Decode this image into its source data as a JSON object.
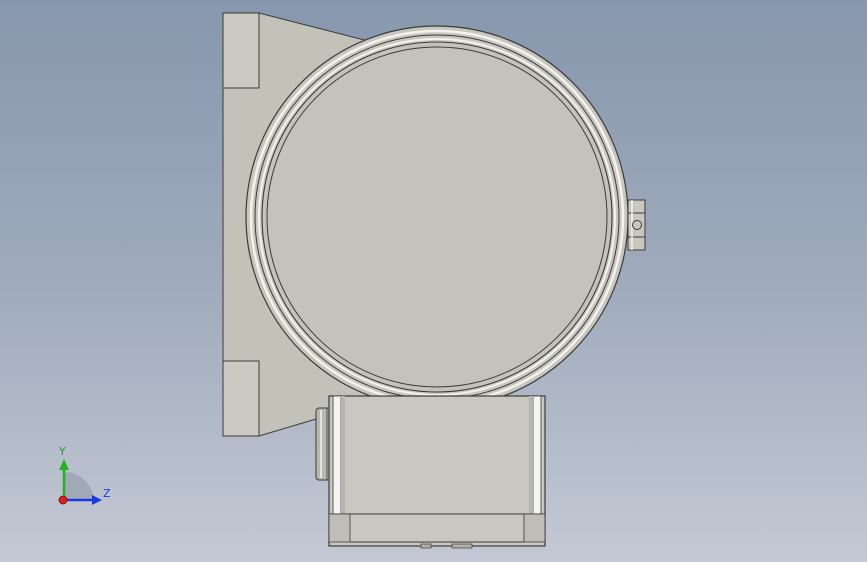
{
  "triad": {
    "y_label": "Y",
    "z_label": "Z",
    "colors": {
      "y_axis": "#1fb51f",
      "z_axis": "#1a3adf",
      "x_axis": "#e21a1a",
      "text": "#1a3adf",
      "y_text": "#2e9b2e"
    }
  },
  "colors": {
    "background_top": "#8797ad",
    "background_bottom": "#c4c9d4",
    "part_fill": "#c3c2b9",
    "part_fill_light": "#cfcec6",
    "edge": "#3a3a3a",
    "highlight": "#f2f2ee"
  }
}
